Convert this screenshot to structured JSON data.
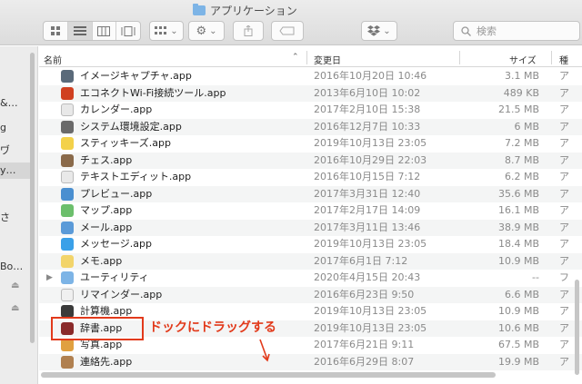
{
  "window": {
    "title": "アプリケーション"
  },
  "toolbar": {
    "search_placeholder": "検索"
  },
  "sidebar": {
    "items": [
      {
        "label": "&…"
      },
      {
        "label": "g"
      },
      {
        "label": "ヷ"
      },
      {
        "label": "y…"
      },
      {
        "label": "さ"
      },
      {
        "label": "Bo…"
      }
    ]
  },
  "header": {
    "name": "名前",
    "date": "変更日",
    "size": "サイズ",
    "kind": "種"
  },
  "rows": [
    {
      "name": "イメージキャプチャ.app",
      "date": "2016年10月20日 10:46",
      "size": "3.1 MB",
      "kind": "ア",
      "icon_color": "#5a6a7a"
    },
    {
      "name": "エコネクトWi-Fi接続ツール.app",
      "date": "2013年6月10日 10:02",
      "size": "489 KB",
      "kind": "ア",
      "icon_color": "#d04020"
    },
    {
      "name": "カレンダー.app",
      "date": "2017年2月10日 15:38",
      "size": "21.5 MB",
      "kind": "ア",
      "icon_color": "#e8e8e8"
    },
    {
      "name": "システム環境設定.app",
      "date": "2016年12月7日 10:33",
      "size": "6 MB",
      "kind": "ア",
      "icon_color": "#6a6a6a"
    },
    {
      "name": "スティッキーズ.app",
      "date": "2019年10月13日 23:05",
      "size": "7.2 MB",
      "kind": "ア",
      "icon_color": "#f3d14a"
    },
    {
      "name": "チェス.app",
      "date": "2016年10月29日 22:03",
      "size": "8.7 MB",
      "kind": "ア",
      "icon_color": "#8a6a4a"
    },
    {
      "name": "テキストエディット.app",
      "date": "2016年10月15日 7:12",
      "size": "6.2 MB",
      "kind": "ア",
      "icon_color": "#e9e9e9"
    },
    {
      "name": "プレビュー.app",
      "date": "2017年3月31日 12:40",
      "size": "35.6 MB",
      "kind": "ア",
      "icon_color": "#4a8fd0"
    },
    {
      "name": "マップ.app",
      "date": "2017年2月17日 14:09",
      "size": "16.1 MB",
      "kind": "ア",
      "icon_color": "#6cbf6c"
    },
    {
      "name": "メール.app",
      "date": "2017年3月11日 13:46",
      "size": "38.9 MB",
      "kind": "ア",
      "icon_color": "#5a9ad8"
    },
    {
      "name": "メッセージ.app",
      "date": "2019年10月13日 23:05",
      "size": "18.4 MB",
      "kind": "ア",
      "icon_color": "#3aa0e8"
    },
    {
      "name": "メモ.app",
      "date": "2017年6月1日 7:12",
      "size": "10.9 MB",
      "kind": "ア",
      "icon_color": "#f2d46a"
    },
    {
      "name": "ユーティリティ",
      "date": "2020年4月15日 20:43",
      "size": "--",
      "kind": "フ",
      "icon_color": "#7db4e6",
      "folder": true
    },
    {
      "name": "リマインダー.app",
      "date": "2016年6月23日 9:50",
      "size": "6.6 MB",
      "kind": "ア",
      "icon_color": "#f0f0f0"
    },
    {
      "name": "計算機.app",
      "date": "2019年10月13日 23:05",
      "size": "10.9 MB",
      "kind": "ア",
      "icon_color": "#3a3a3a"
    },
    {
      "name": "辞書.app",
      "date": "2019年10月13日 23:05",
      "size": "10.6 MB",
      "kind": "ア",
      "icon_color": "#8a2a2a"
    },
    {
      "name": "写真.app",
      "date": "2017年6月21日 9:11",
      "size": "67.5 MB",
      "kind": "ア",
      "icon_color": "#e0a040"
    },
    {
      "name": "連絡先.app",
      "date": "2016年6月29日 8:07",
      "size": "19.9 MB",
      "kind": "ア",
      "icon_color": "#b08050"
    }
  ],
  "annotation": {
    "text": "ドックにドラッグする",
    "color": "#e23a1b"
  }
}
